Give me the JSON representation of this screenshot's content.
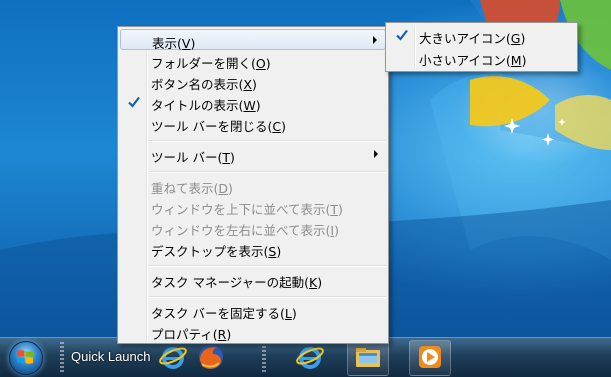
{
  "colors": {
    "menu_bg": "#f0f0f0",
    "check": "#1a5fb4",
    "disabled_text": "#8d8d8d",
    "highlight_border": "#a8c4e3"
  },
  "context_menu": {
    "items": [
      {
        "label": "表示(V)",
        "mnemonic": "V",
        "submenu": true,
        "highlighted": true
      },
      {
        "label": "フォルダーを開く(O)",
        "mnemonic": "O"
      },
      {
        "label": "ボタン名の表示(X)",
        "mnemonic": "X"
      },
      {
        "label": "タイトルの表示(W)",
        "mnemonic": "W",
        "checked": true
      },
      {
        "label": "ツール バーを閉じる(C)",
        "mnemonic": "C"
      },
      {
        "label": "ツール バー(T)",
        "mnemonic": "T",
        "submenu": true
      },
      {
        "label": "重ねて表示(D)",
        "mnemonic": "D",
        "disabled": true
      },
      {
        "label": "ウィンドウを上下に並べて表示(T)",
        "mnemonic": "T",
        "disabled": true
      },
      {
        "label": "ウィンドウを左右に並べて表示(I)",
        "mnemonic": "I",
        "disabled": true
      },
      {
        "label": "デスクトップを表示(S)",
        "mnemonic": "S"
      },
      {
        "label": "タスク マネージャーの起動(K)",
        "mnemonic": "K"
      },
      {
        "label": "タスク バーを固定する(L)",
        "mnemonic": "L"
      },
      {
        "label": "プロパティ(R)",
        "mnemonic": "R"
      }
    ]
  },
  "view_submenu": {
    "items": [
      {
        "label": "大きいアイコン(G)",
        "mnemonic": "G",
        "checked": true
      },
      {
        "label": "小さいアイコン(M)",
        "mnemonic": "M"
      }
    ]
  },
  "taskbar": {
    "quick_launch_label": "Quick Launch",
    "icons": [
      "start-orb-icon",
      "internet-explorer-icon",
      "firefox-icon",
      "internet-explorer-icon",
      "windows-explorer-icon",
      "media-player-icon"
    ]
  }
}
